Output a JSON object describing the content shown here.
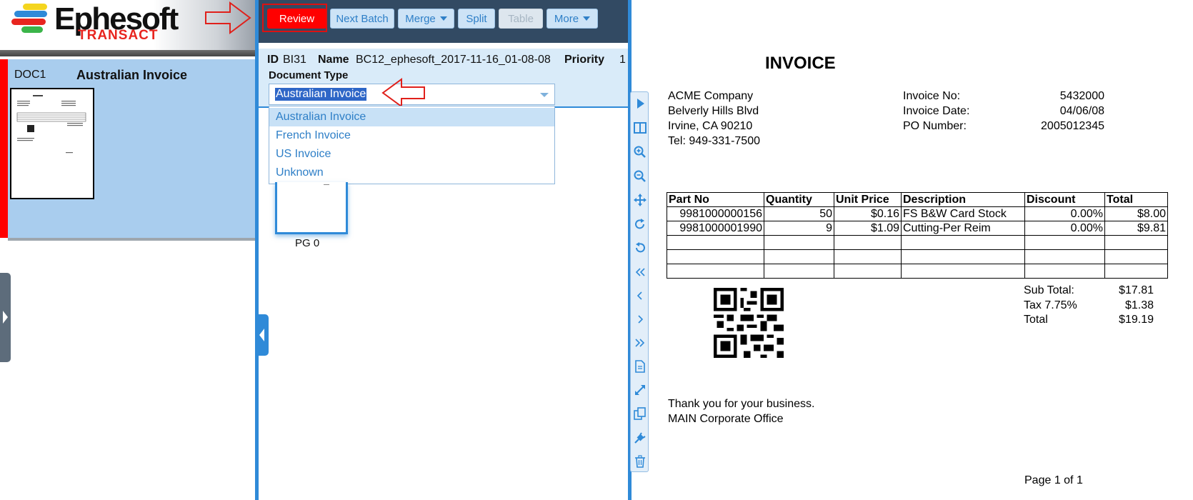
{
  "brand": {
    "logo_main": "Ephesoft",
    "logo_sub": "TRANSACT"
  },
  "document": {
    "id": "DOC1",
    "title": "Australian Invoice"
  },
  "toolbar": {
    "review": "Review",
    "next_batch": "Next Batch",
    "merge": "Merge",
    "split": "Split",
    "table": "Table",
    "more": "More"
  },
  "batch_info": {
    "id_label": "ID",
    "id_value": "BI31",
    "name_label": "Name",
    "name_value": "BC12_ephesoft_2017-11-16_01-08-08",
    "priority_label": "Priority",
    "priority_value": "1",
    "doctype_label": "Document Type",
    "doctype_selected": "Australian Invoice"
  },
  "doctype_options": [
    "Australian Invoice",
    "French Invoice",
    "US Invoice",
    "Unknown"
  ],
  "page": {
    "label": "PG 0"
  },
  "invoice": {
    "heading": "INVOICE",
    "company": [
      "ACME Company",
      "Belverly Hills Blvd",
      "Irvine, CA 90210",
      "Tel: 949-331-7500"
    ],
    "meta": [
      {
        "label": "Invoice No:",
        "value": "5432000"
      },
      {
        "label": "Invoice Date:",
        "value": "04/06/08"
      },
      {
        "label": "PO Number:",
        "value": "2005012345"
      }
    ],
    "columns": [
      "Part No",
      "Quantity",
      "Unit Price",
      "Description",
      "Discount",
      "Total"
    ],
    "rows": [
      [
        "9981000000156",
        "50",
        "$0.16",
        "FS B&W Card Stock",
        "0.00%",
        "$8.00"
      ],
      [
        "9981000001990",
        "9",
        "$1.09",
        "Cutting-Per Reim",
        "0.00%",
        "$9.81"
      ]
    ],
    "totals": [
      {
        "label": "Sub Total:",
        "value": "$17.81"
      },
      {
        "label": "Tax 7.75%",
        "value": "$1.38"
      },
      {
        "label": "Total",
        "value": "$19.19"
      }
    ],
    "footer": [
      "Thank you for your business.",
      "MAIN Corporate Office"
    ],
    "page_of": "Page 1 of 1"
  },
  "colors": {
    "accent": "#2f8ad8",
    "review": "#ff0000",
    "toolbar": "#324a63",
    "doc_panel": "#a9cdee"
  },
  "icons": [
    "play-icon",
    "split-view-icon",
    "zoom-in-icon",
    "zoom-out-icon",
    "move-icon",
    "rotate-cw-icon",
    "rotate-ccw-icon",
    "first-page-icon",
    "prev-page-icon",
    "next-page-icon",
    "last-page-icon",
    "document-icon",
    "fit-icon",
    "copy-icon",
    "plug-icon",
    "trash-icon"
  ]
}
